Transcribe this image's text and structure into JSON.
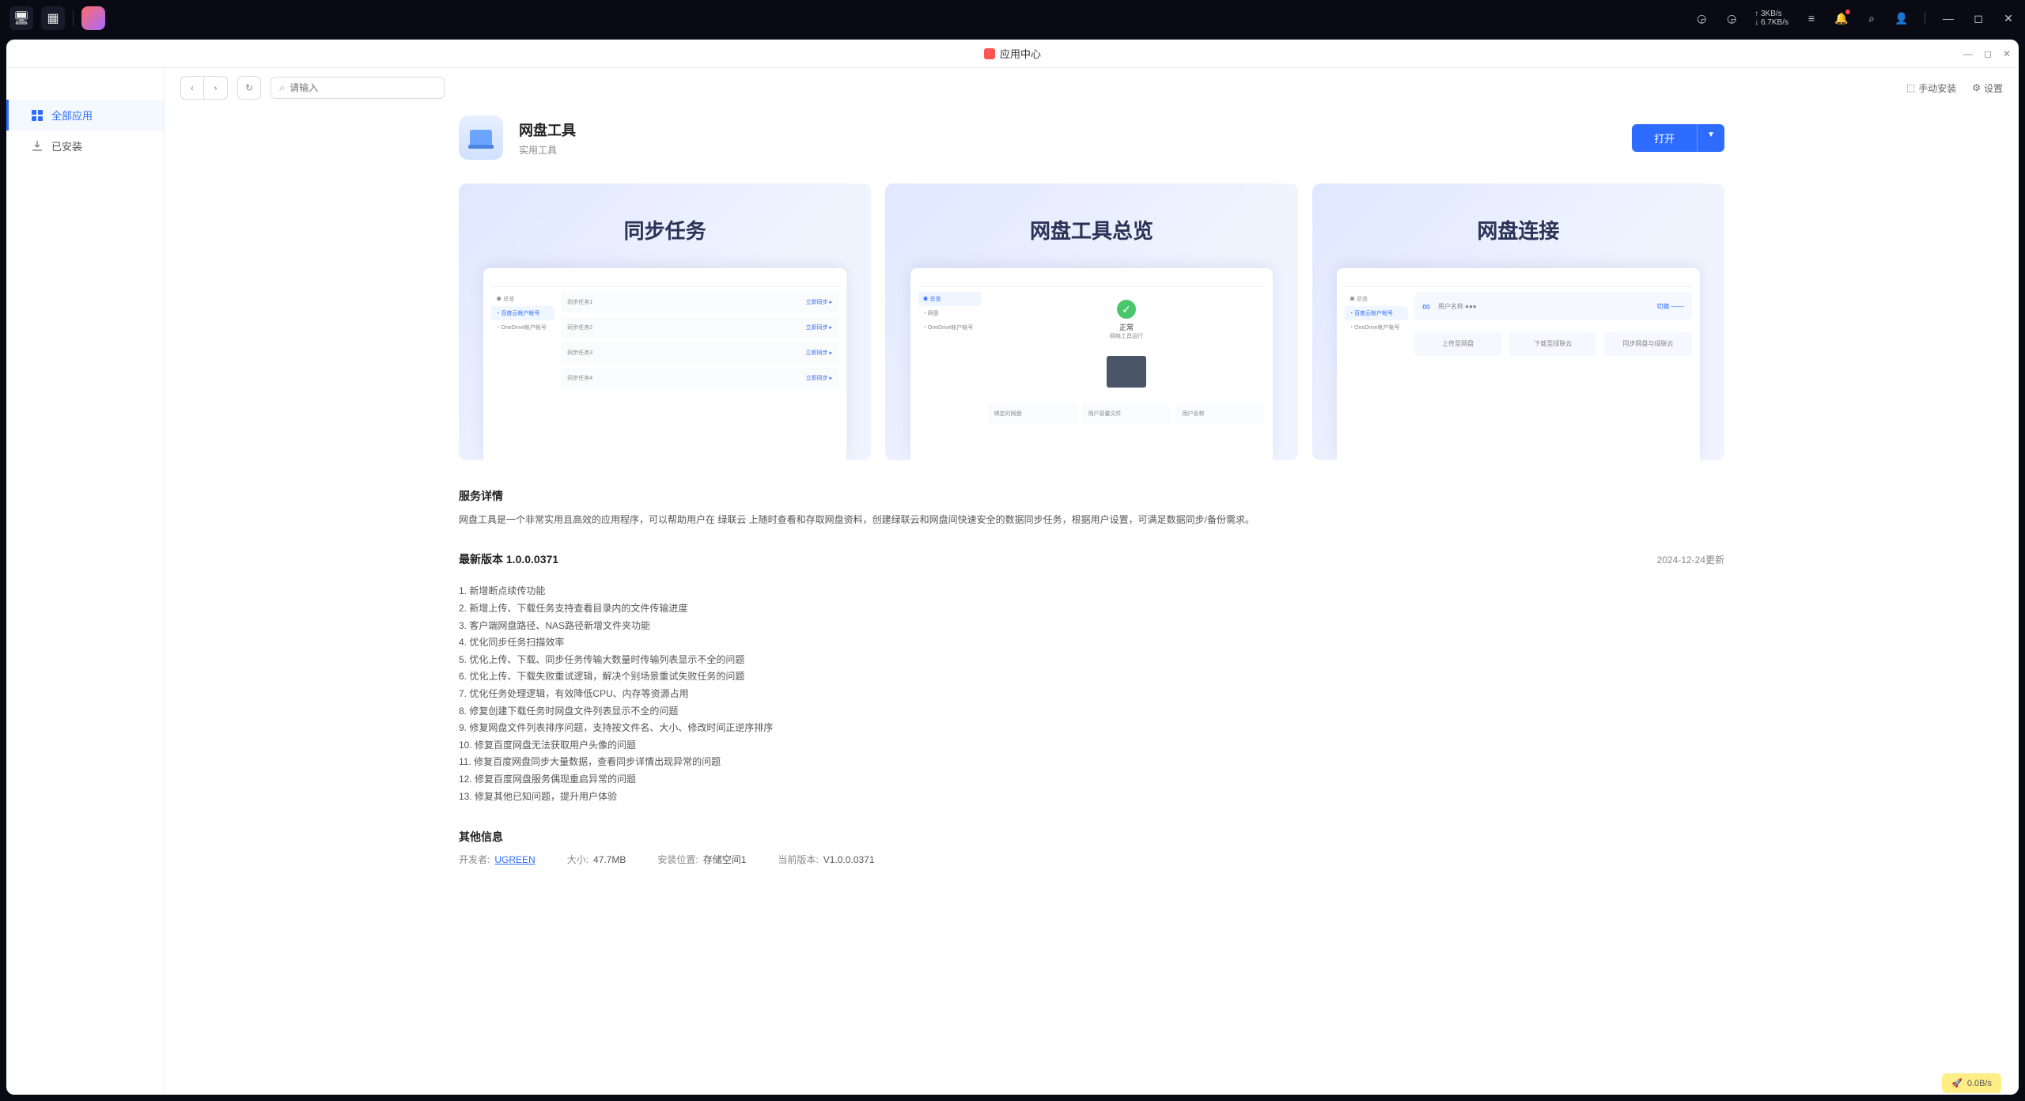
{
  "sysbar": {
    "net_up": "↑ 3KB/s",
    "net_down": "↓ 6.7KB/s",
    "cpu": "CPU",
    "ram": "RAM"
  },
  "window": {
    "title": "应用中心"
  },
  "sidebar": {
    "items": [
      {
        "label": "全部应用",
        "active": true
      },
      {
        "label": "已安装",
        "active": false
      }
    ]
  },
  "toolbar": {
    "search_placeholder": "请输入",
    "manual_install": "手动安装",
    "settings": "设置"
  },
  "app": {
    "name": "网盘工具",
    "category": "实用工具",
    "open_label": "打开"
  },
  "screenshots": [
    {
      "title": "同步任务"
    },
    {
      "title": "网盘工具总览"
    },
    {
      "title": "网盘连接"
    }
  ],
  "service": {
    "heading": "服务详情",
    "desc": "网盘工具是一个非常实用且高效的应用程序，可以帮助用户在 绿联云 上随时查看和存取网盘资料，创建绿联云和网盘间快速安全的数据同步任务，根据用户设置，可满足数据同步/备份需求。"
  },
  "version": {
    "heading_prefix": "最新版本",
    "number": "1.0.0.0371",
    "update_date": "2024-12-24更新",
    "changelog": [
      "1. 新增断点续传功能",
      "2. 新增上传、下载任务支持查看目录内的文件传输进度",
      "3. 客户端网盘路径、NAS路径新增文件夹功能",
      "4. 优化同步任务扫描效率",
      "5. 优化上传、下载、同步任务传输大数量时传输列表显示不全的问题",
      "6. 优化上传、下载失败重试逻辑，解决个别场景重试失败任务的问题",
      "7. 优化任务处理逻辑，有效降低CPU、内存等资源占用",
      "8. 修复创建下载任务时网盘文件列表显示不全的问题",
      "9. 修复网盘文件列表排序问题，支持按文件名、大小、修改时间正逆序排序",
      "10. 修复百度网盘无法获取用户头像的问题",
      "11. 修复百度网盘同步大量数据，查看同步详情出现异常的问题",
      "12. 修复百度网盘服务偶现重启异常的问题",
      "13. 修复其他已知问题，提升用户体验"
    ]
  },
  "other": {
    "heading": "其他信息",
    "dev_label": "开发者:",
    "dev": "UGREEN",
    "size_label": "大小:",
    "size": "47.7MB",
    "loc_label": "安装位置:",
    "loc": "存储空间1",
    "curver_label": "当前版本:",
    "curver": "V1.0.0.0371"
  },
  "footer_widget": "0.0B/s"
}
